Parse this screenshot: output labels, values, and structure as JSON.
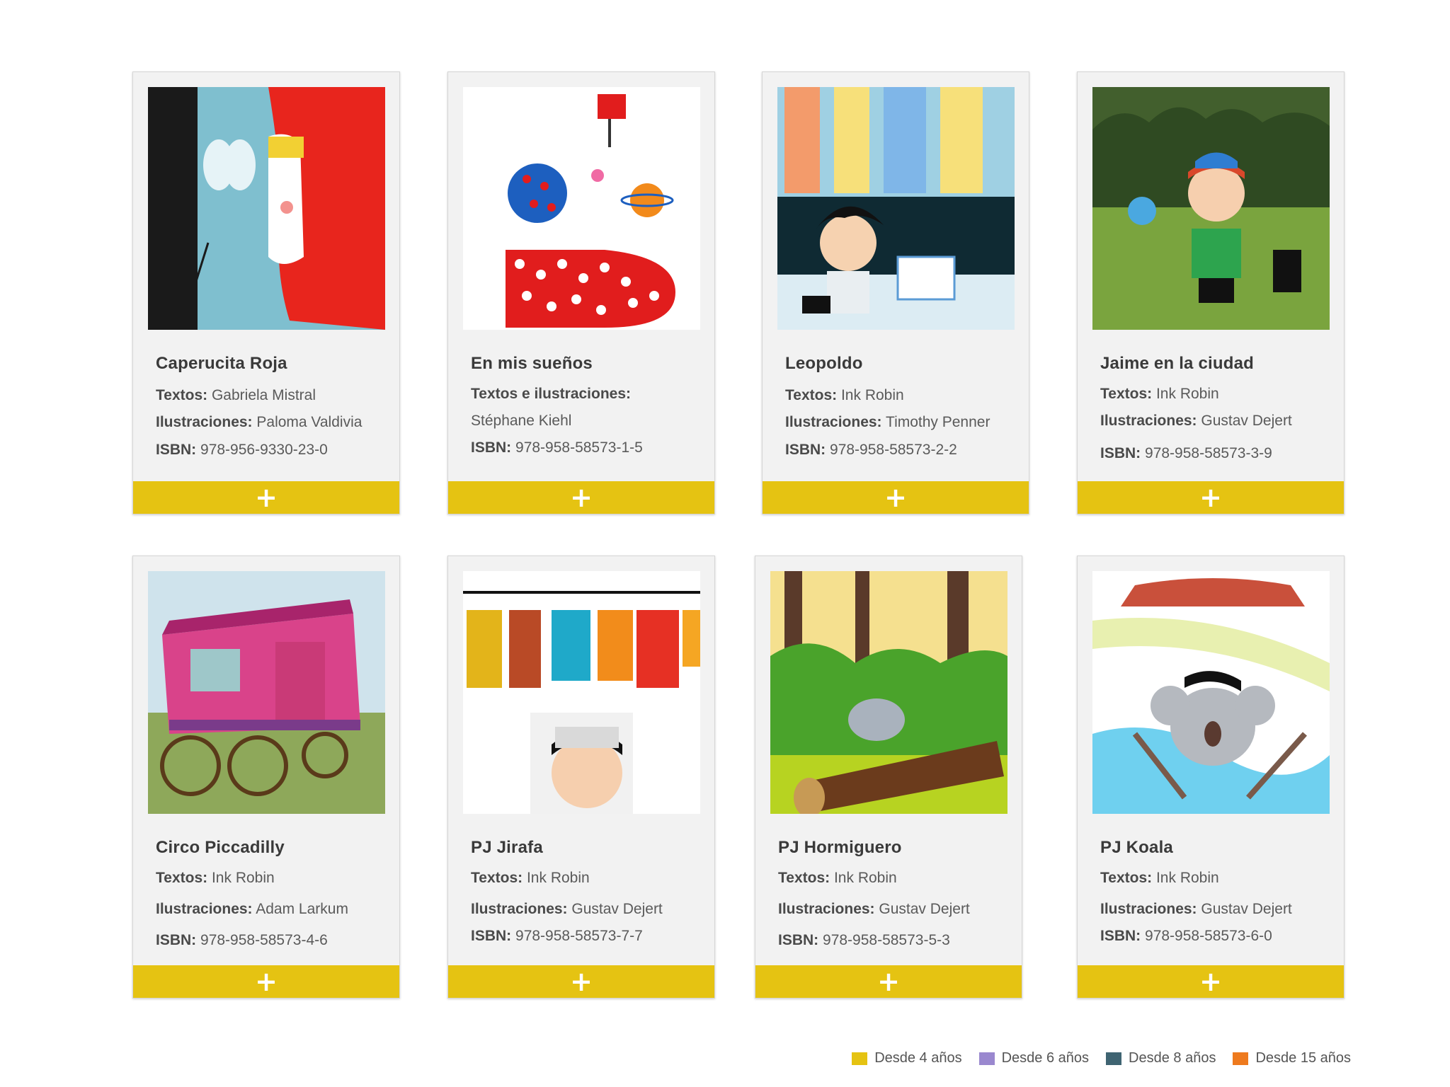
{
  "books": [
    {
      "title": "Caperucita Roja",
      "l1_label": "Textos:",
      "l1_value": "Gabriela Mistral",
      "l2_label": "Ilustraciones:",
      "l2_value": "Paloma Valdivia",
      "l3_label": "ISBN:",
      "l3_value": "978-956-9330-23-0",
      "add_label": "+"
    },
    {
      "title": "En mis sueños",
      "l1_label": "Textos e ilustraciones:",
      "l1_value": "",
      "l2_label": "",
      "l2_value": "Stéphane Kiehl",
      "l3_label": "ISBN:",
      "l3_value": "978-958-58573-1-5",
      "add_label": "+"
    },
    {
      "title": "Leopoldo",
      "l1_label": "Textos:",
      "l1_value": "Ink Robin",
      "l2_label": "Ilustraciones:",
      "l2_value": "Timothy Penner",
      "l3_label": "ISBN:",
      "l3_value": "978-958-58573-2-2",
      "add_label": "+"
    },
    {
      "title": "Jaime en la ciudad",
      "l1_label": "Textos:",
      "l1_value": "Ink Robin",
      "l2_label": "Ilustraciones:",
      "l2_value": "Gustav Dejert",
      "l3_label": "ISBN:",
      "l3_value": "978-958-58573-3-9",
      "add_label": "+"
    },
    {
      "title": "Circo Piccadilly",
      "l1_label": "Textos:",
      "l1_value": "Ink Robin",
      "l2_label": "Ilustraciones:",
      "l2_value": "Adam Larkum",
      "l3_label": "ISBN:",
      "l3_value": "978-958-58573-4-6",
      "add_label": "+"
    },
    {
      "title": "PJ Jirafa",
      "l1_label": "Textos:",
      "l1_value": "Ink Robin",
      "l2_label": "Ilustraciones:",
      "l2_value": "Gustav Dejert",
      "l3_label": "ISBN:",
      "l3_value": "978-958-58573-7-7",
      "add_label": "+"
    },
    {
      "title": "PJ Hormiguero",
      "l1_label": "Textos:",
      "l1_value": "Ink Robin",
      "l2_label": "Ilustraciones:",
      "l2_value": "Gustav Dejert",
      "l3_label": "ISBN:",
      "l3_value": "978-958-58573-5-3",
      "add_label": "+"
    },
    {
      "title": "PJ Koala",
      "l1_label": "Textos:",
      "l1_value": "Ink Robin",
      "l2_label": "Ilustraciones:",
      "l2_value": "Gustav Dejert",
      "l3_label": "ISBN:",
      "l3_value": "978-958-58573-6-0",
      "add_label": "+"
    }
  ],
  "legend": [
    {
      "label": "Desde 4 años",
      "color": "#e5c312"
    },
    {
      "label": "Desde 6 años",
      "color": "#9a88cf"
    },
    {
      "label": "Desde 8 años",
      "color": "#3f6472"
    },
    {
      "label": "Desde 15 años",
      "color": "#ee7a1e"
    }
  ],
  "covers": [
    "red-riding-hood-illustration",
    "polka-dot-dream-illustration",
    "boy-newspaper-illustration",
    "boy-park-illustration",
    "circus-wagon-illustration",
    "pajamas-clothesline-illustration",
    "jungle-anteater-illustration",
    "australia-koala-illustration"
  ]
}
